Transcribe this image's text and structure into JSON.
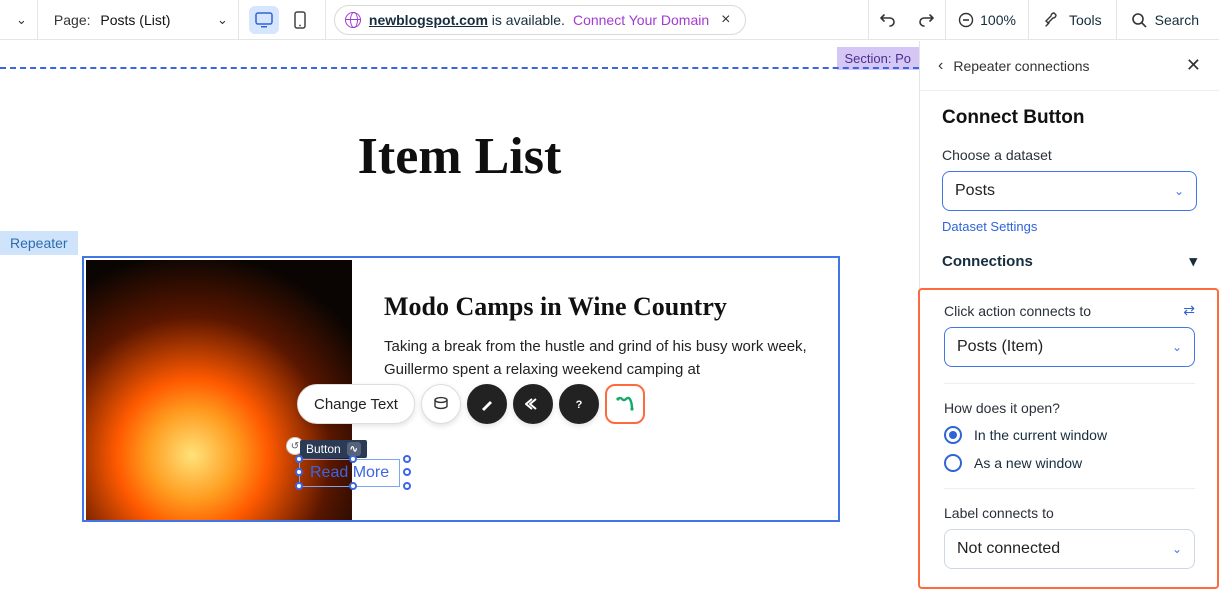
{
  "topbar": {
    "page_label": "Page:",
    "page_value": "Posts (List)",
    "domain_name": "newblogspot.com",
    "domain_available": " is available. ",
    "connect_domain": "Connect Your Domain",
    "zoom": "100%",
    "tools": "Tools",
    "search": "Search"
  },
  "canvas": {
    "section_tag": "Section: Po",
    "heading": "Item List",
    "repeater_tag": "Repeater",
    "item_title": "Modo Camps in Wine Country",
    "item_body": "Taking a break from the hustle and grind of his busy work week, Guillermo spent a relaxing weekend camping at ",
    "button_tag": "Button",
    "readmore": "Read More",
    "action_change_text": "Change Text"
  },
  "panel": {
    "breadcrumb": "Repeater connections",
    "title": "Connect Button",
    "choose_dataset_label": "Choose a dataset",
    "dataset_value": "Posts",
    "dataset_settings": "Dataset Settings",
    "connections_label": "Connections",
    "click_action_label": "Click action connects to",
    "click_action_value": "Posts (Item)",
    "how_open_label": "How does it open?",
    "radio_current": "In the current window",
    "radio_new": "As a new window",
    "label_connects_label": "Label connects to",
    "label_connects_value": "Not connected"
  }
}
